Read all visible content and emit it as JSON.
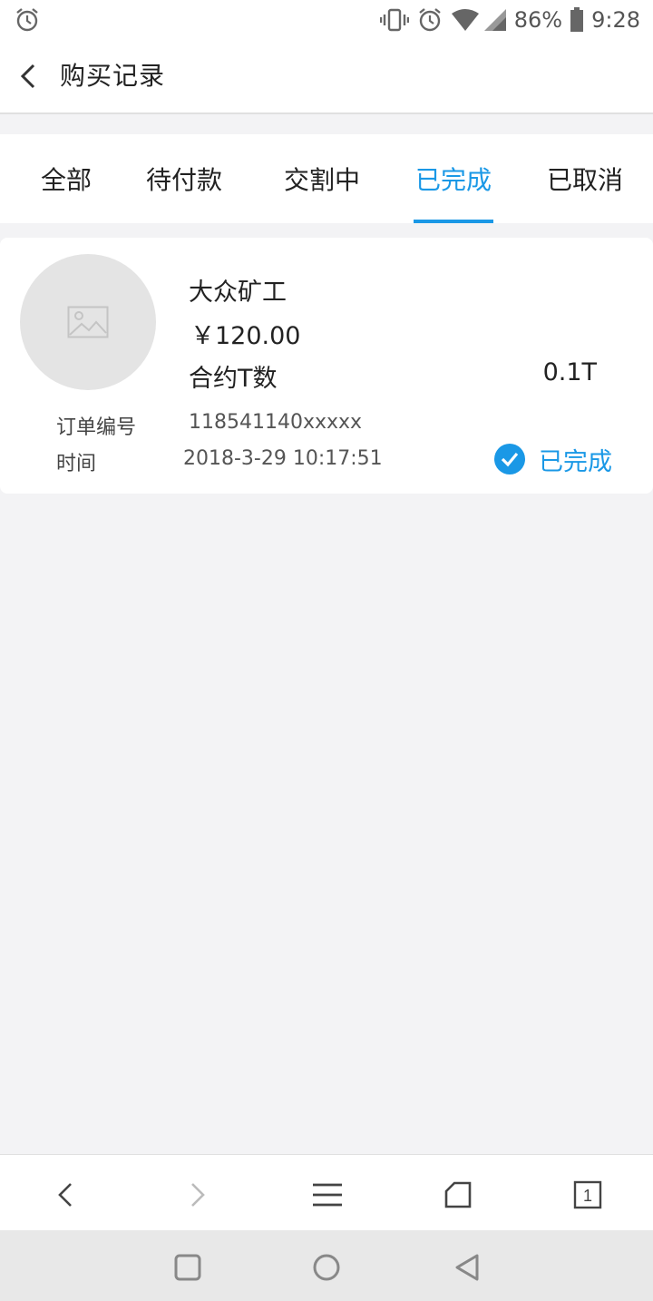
{
  "status_bar": {
    "battery": "86%",
    "time": "9:28",
    "icons": [
      "alarm-icon",
      "vibrate-icon",
      "alarm-icon",
      "wifi-icon",
      "signal-icon",
      "battery-icon"
    ]
  },
  "header": {
    "title": "购买记录",
    "back_icon": "chevron-left-icon"
  },
  "tabs": [
    {
      "label": "全部",
      "active": false
    },
    {
      "label": "待付款",
      "active": false
    },
    {
      "label": "交割中",
      "active": false
    },
    {
      "label": "已完成",
      "active": true
    },
    {
      "label": "已取消",
      "active": false
    }
  ],
  "order": {
    "product_name": "大众矿工",
    "price": "￥120.00",
    "contract_label": "合约T数",
    "contract_value": "0.1T",
    "order_no_label": "订单编号",
    "order_no_value": "118541140xxxxx",
    "time_label": "时间",
    "time_value": "2018-3-29 10:17:51",
    "status": "已完成",
    "status_icon": "check-circle-icon",
    "thumbnail_icon": "image-placeholder-icon"
  },
  "browser_bar": {
    "tab_count": "1",
    "icons": [
      "back-icon",
      "forward-icon",
      "menu-icon",
      "home-icon",
      "tabs-icon"
    ]
  },
  "nav_bar": {
    "icons": [
      "recent-apps-icon",
      "home-circle-icon",
      "back-triangle-icon"
    ]
  },
  "colors": {
    "accent": "#1a98e6",
    "background": "#f3f3f5"
  }
}
